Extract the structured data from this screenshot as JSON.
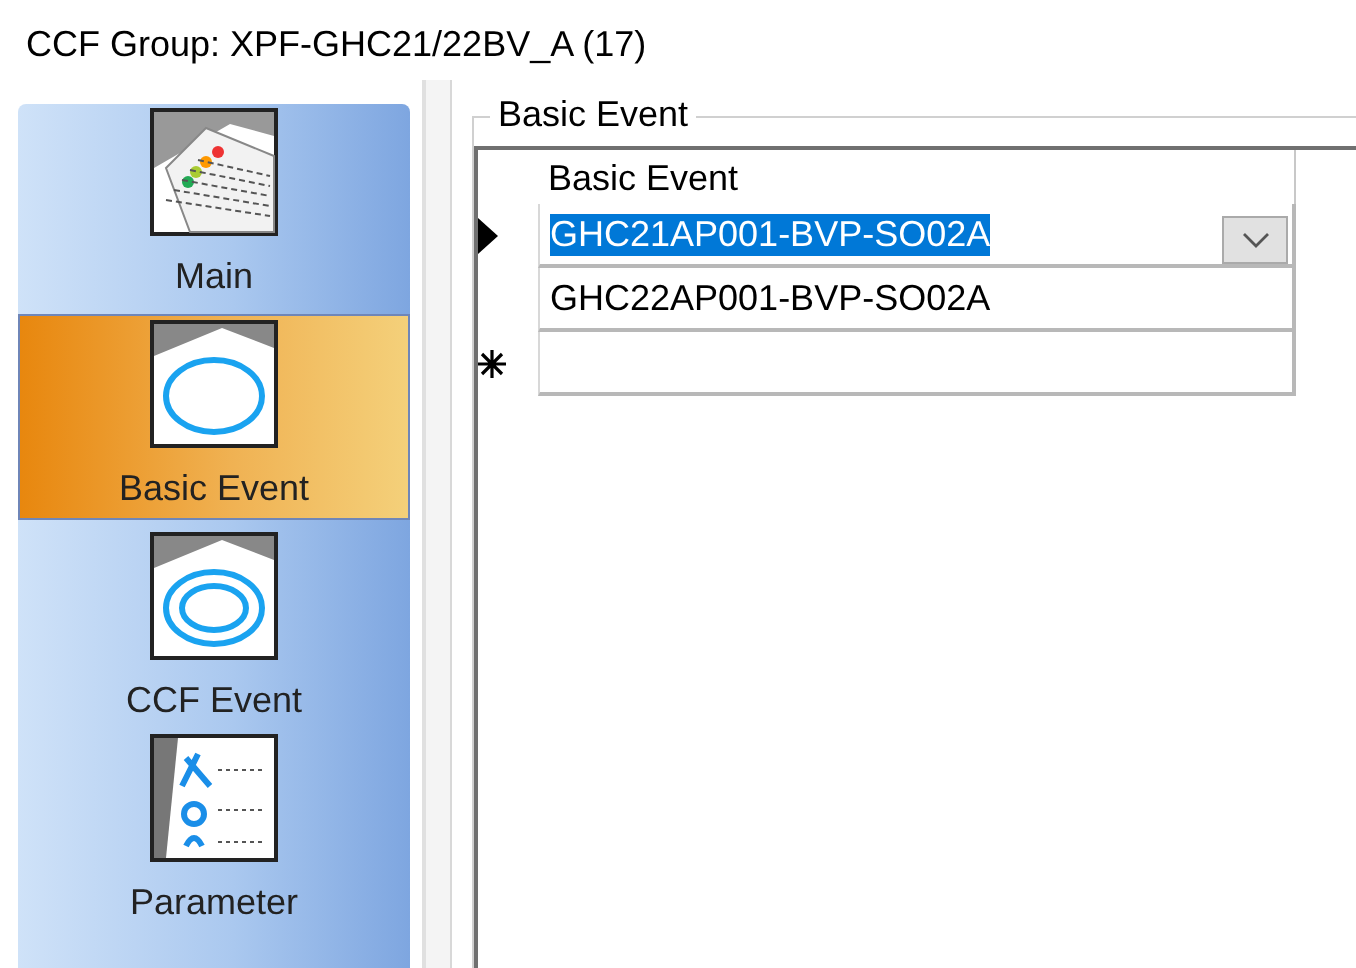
{
  "title": "CCF Group: XPF-GHC21/22BV_A (17)",
  "sidebar": {
    "items": [
      {
        "label": "Main",
        "kind": "main",
        "selected": false
      },
      {
        "label": "Basic Event",
        "kind": "basic",
        "selected": true
      },
      {
        "label": "CCF Event",
        "kind": "ccf",
        "selected": false
      },
      {
        "label": "Parameter",
        "kind": "parameter",
        "selected": false
      }
    ]
  },
  "group": {
    "legend": "Basic Event",
    "grid": {
      "column": "Basic Event",
      "rows": [
        {
          "kind": "data",
          "value": "GHC21AP001-BVP-SO02A",
          "selected": true
        },
        {
          "kind": "data",
          "value": "GHC22AP001-BVP-SO02A",
          "selected": false
        },
        {
          "kind": "new"
        }
      ]
    }
  }
}
